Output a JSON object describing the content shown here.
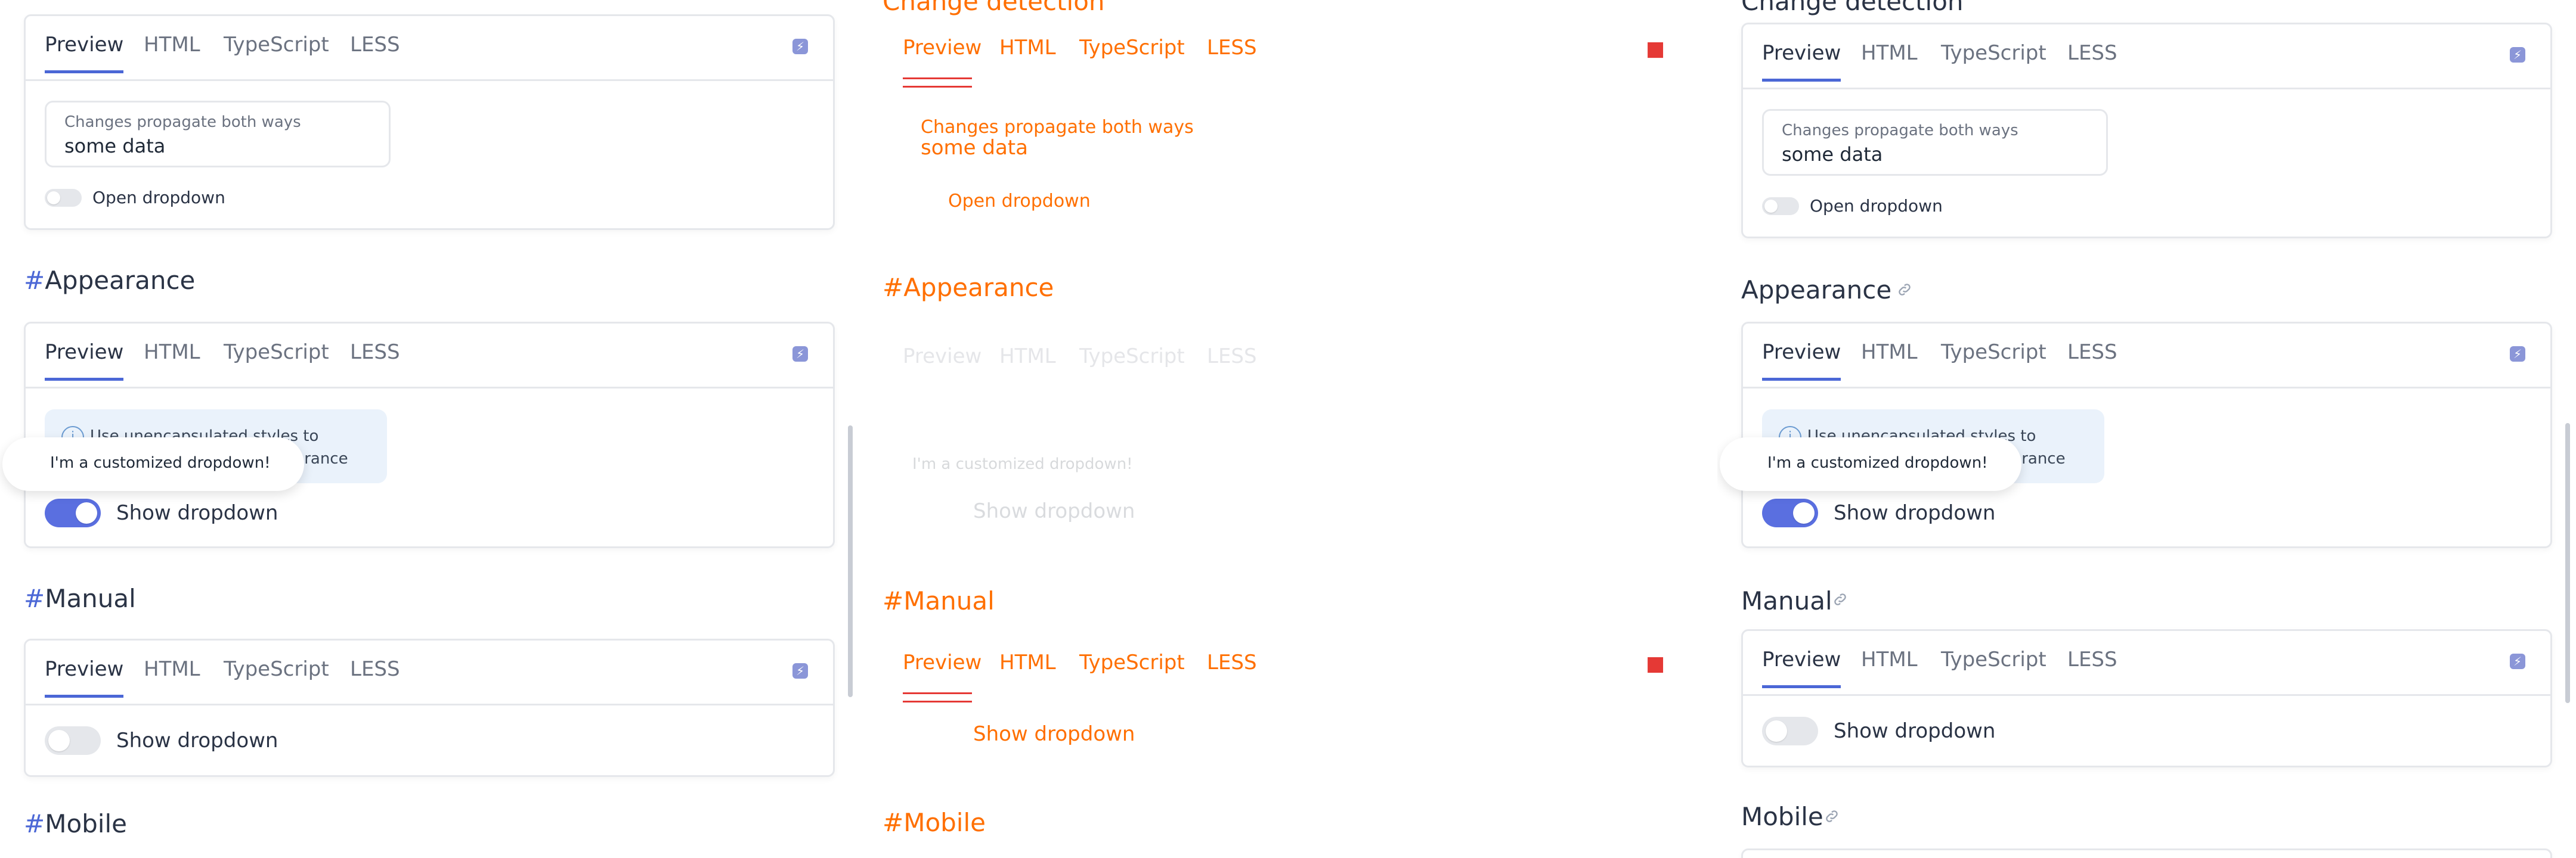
{
  "tabs": [
    "Preview",
    "HTML",
    "TypeScript",
    "LESS"
  ],
  "sections": {
    "change_detection": {
      "title": "Change detection"
    },
    "appearance": {
      "title": "Appearance"
    },
    "manual": {
      "title": "Manual"
    },
    "mobile": {
      "title": "Mobile"
    }
  },
  "hash": "#",
  "field": {
    "label": "Changes propagate both ways",
    "value": "some data"
  },
  "toggles": {
    "open_dropdown": "Open dropdown",
    "show_dropdown": "Show dropdown"
  },
  "note": {
    "line1": "Use unencapsulated styles to",
    "line2": "customize dropdown appearance"
  },
  "dropdown_text": "I'm a customized dropdown!",
  "colors": {
    "accent": "#4b67d6",
    "diff_orange": "#ff6f00",
    "diff_red": "#e53935"
  },
  "icons": {
    "tab_action": "lightning-icon",
    "anchor": "link-icon",
    "note": "info-icon"
  }
}
